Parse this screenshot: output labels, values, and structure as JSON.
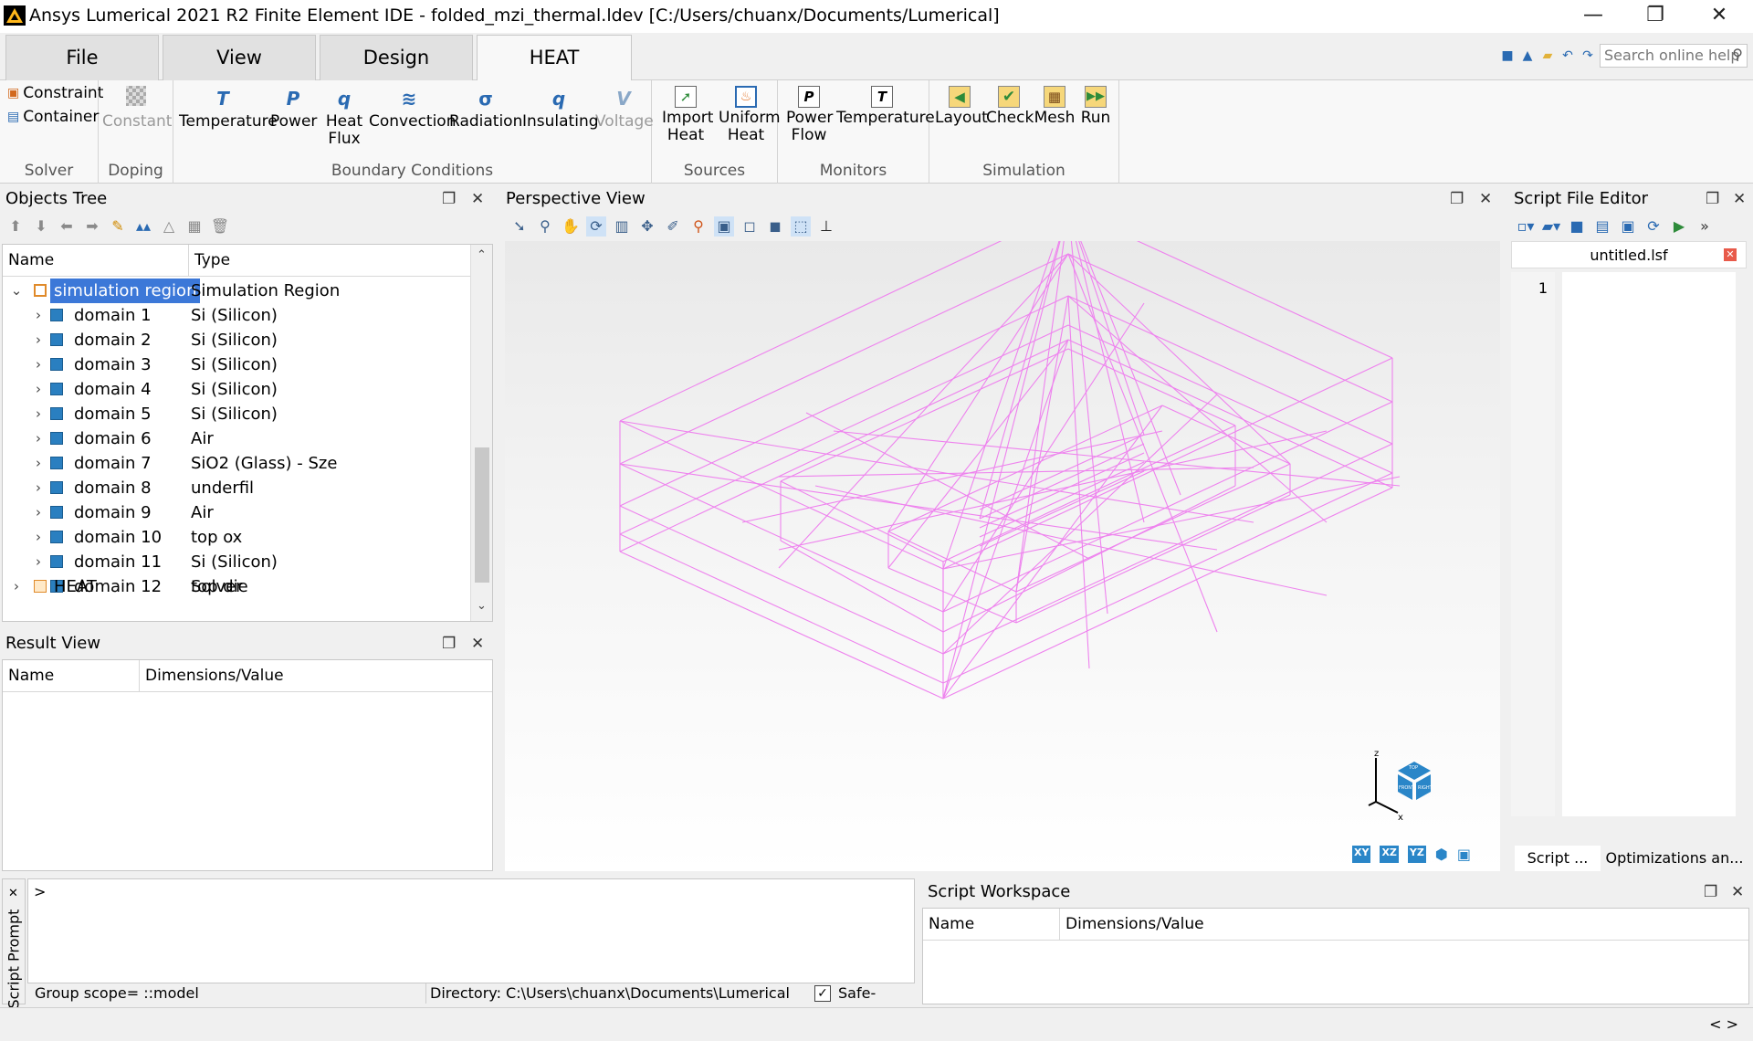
{
  "window": {
    "title": "Ansys Lumerical 2021 R2 Finite Element IDE - folded_mzi_thermal.ldev [C:/Users/chuanx/Documents/Lumerical]",
    "minimize": "—",
    "restore": "❐",
    "close": "✕"
  },
  "ribbon": {
    "tabs": [
      "File",
      "View",
      "Design",
      "HEAT"
    ],
    "active_tab": "HEAT",
    "search_placeholder": "Search online help",
    "groups": {
      "solver": {
        "label": "Solver",
        "constraint": "Constraint",
        "container": "Container"
      },
      "doping": {
        "label": "Doping",
        "constant": "Constant"
      },
      "boundary": {
        "label": "Boundary Conditions",
        "buttons": [
          "Temperature",
          "Power",
          "Heat Flux",
          "Convection",
          "Radiation",
          "Insulating",
          "Voltage"
        ]
      },
      "sources": {
        "label": "Sources",
        "buttons": [
          "Import Heat",
          "Uniform Heat"
        ]
      },
      "monitors": {
        "label": "Monitors",
        "buttons": [
          "Power Flow",
          "Temperature"
        ]
      },
      "simulation": {
        "label": "Simulation",
        "buttons": [
          "Layout",
          "Check",
          "Mesh",
          "Run"
        ]
      }
    }
  },
  "objects_tree": {
    "title": "Objects Tree",
    "col_name": "Name",
    "col_type": "Type",
    "root": {
      "name": "simulation region",
      "type": "Simulation Region"
    },
    "items": [
      {
        "name": "domain 1",
        "type": "Si (Silicon)"
      },
      {
        "name": "domain 2",
        "type": "Si (Silicon)"
      },
      {
        "name": "domain 3",
        "type": "Si (Silicon)"
      },
      {
        "name": "domain 4",
        "type": "Si (Silicon)"
      },
      {
        "name": "domain 5",
        "type": "Si (Silicon)"
      },
      {
        "name": "domain 6",
        "type": "Air"
      },
      {
        "name": "domain 7",
        "type": "SiO2 (Glass) - Sze"
      },
      {
        "name": "domain 8",
        "type": "underfil"
      },
      {
        "name": "domain 9",
        "type": "Air"
      },
      {
        "name": "domain 10",
        "type": "top ox"
      },
      {
        "name": "domain 11",
        "type": "Si (Silicon)"
      },
      {
        "name": "domain 12",
        "type": "top die"
      }
    ],
    "solver": {
      "name": "HEAT",
      "type": "Solver"
    }
  },
  "result_view": {
    "title": "Result View",
    "col_name": "Name",
    "col_value": "Dimensions/Value"
  },
  "perspective_view": {
    "title": "Perspective View",
    "axis_buttons": [
      "XY",
      "XZ",
      "YZ"
    ],
    "cube_labels": {
      "top": "TOP",
      "front": "FRONT",
      "right": "RIGHT",
      "z": "z",
      "x": "x"
    },
    "wire_color": "#ee82ee"
  },
  "script_editor": {
    "title": "Script File Editor",
    "file_tab": "untitled.lsf",
    "line_number": "1",
    "bottom_tabs": [
      "Script ...",
      "Optimizations an..."
    ]
  },
  "script_prompt": {
    "side_label": "Script Prompt",
    "prompt": ">",
    "group_scope": "Group scope= ::model",
    "directory": "Directory: C:\\Users\\chuanx\\Documents\\Lumerical",
    "safe_mode": "Safe-mode"
  },
  "script_workspace": {
    "title": "Script Workspace",
    "col_name": "Name",
    "col_value": "Dimensions/Value"
  },
  "statusbar": {
    "nav": "< >"
  }
}
